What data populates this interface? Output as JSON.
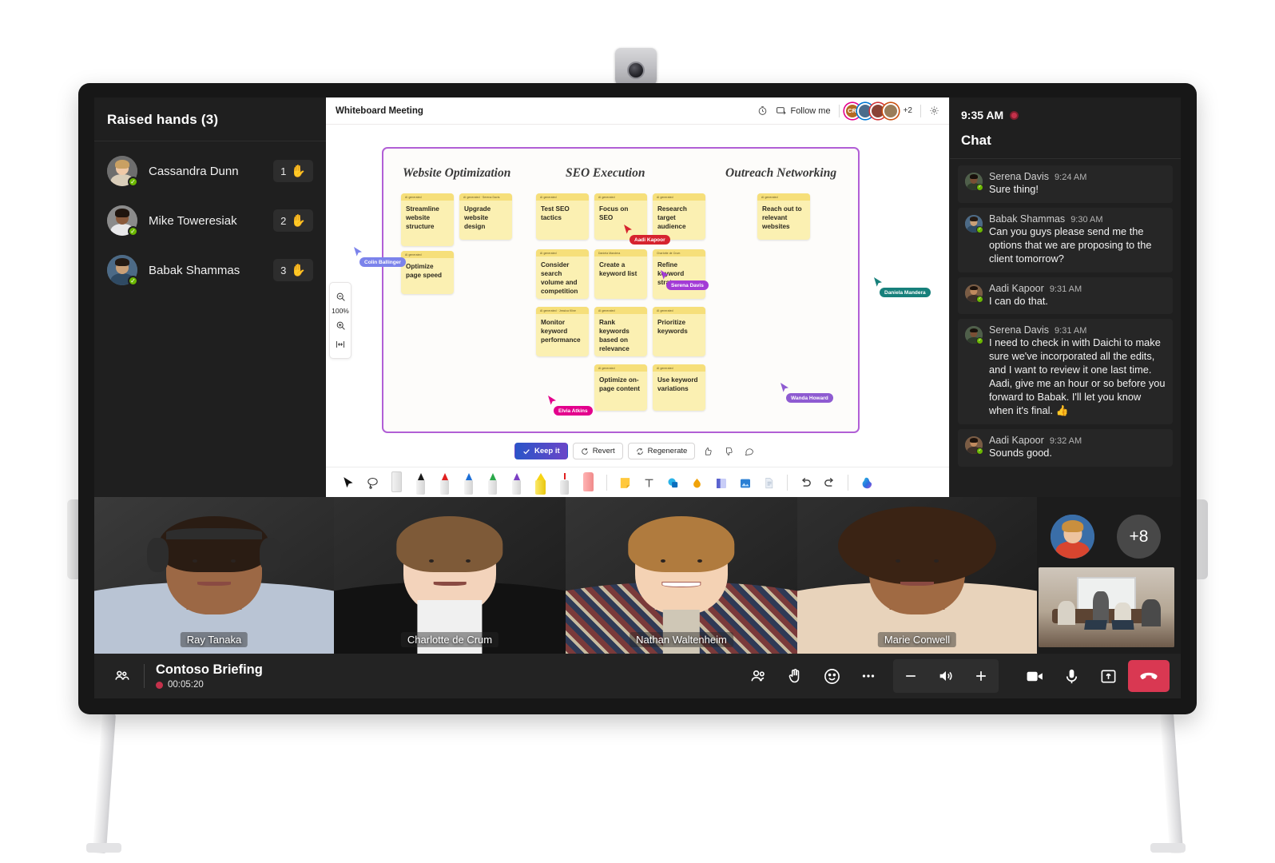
{
  "raised_hands": {
    "title": "Raised hands (3)",
    "items": [
      {
        "name": "Cassandra Dunn",
        "order": "1",
        "hand": "✋"
      },
      {
        "name": "Mike Toweresiak",
        "order": "2",
        "hand": "✋"
      },
      {
        "name": "Babak Shammas",
        "order": "3",
        "hand": "✋"
      }
    ]
  },
  "whiteboard": {
    "title": "Whiteboard Meeting",
    "follow_me": "Follow me",
    "facepile": {
      "initials": "CR",
      "overflow": "+2"
    },
    "zoom": {
      "level": "100%",
      "zoom_out": "zoom-out",
      "zoom_in": "zoom-in",
      "fit": "fit-to-screen"
    },
    "columns": [
      {
        "title": "Website Optimization"
      },
      {
        "title": "SEO Execution"
      },
      {
        "title": "Outreach Networking"
      }
    ],
    "notes": [
      {
        "header": "AI generated",
        "text": "Streamline website structure"
      },
      {
        "header": "AI generated · Serena Davis",
        "text": "Upgrade website design"
      },
      {
        "header": "AI generated",
        "text": "Optimize page speed"
      },
      {
        "header": "AI generated",
        "text": "Test SEO tactics"
      },
      {
        "header": "AI generated",
        "text": "Focus on SEO"
      },
      {
        "header": "AI generated",
        "text": "Research target audience"
      },
      {
        "header": "AI generated",
        "text": "Consider search volume and competition"
      },
      {
        "header": "Daniela Mandera",
        "text": "Create a keyword list"
      },
      {
        "header": "Charlotte de Crum",
        "text": "Refine keyword strategy"
      },
      {
        "header": "AI generated · Jessica Kline",
        "text": "Monitor keyword performance"
      },
      {
        "header": "AI generated",
        "text": "Rank keywords based on relevance"
      },
      {
        "header": "AI generated",
        "text": "Prioritize keywords"
      },
      {
        "header": "AI generated",
        "text": "Optimize on-page content"
      },
      {
        "header": "AI generated",
        "text": "Use keyword variations"
      },
      {
        "header": "AI generated",
        "text": "Reach out to relevant websites"
      }
    ],
    "cursors": [
      {
        "label": "Colin Ballinger",
        "color": "#7b83eb"
      },
      {
        "label": "Aadi Kapoor",
        "color": "#d6232f"
      },
      {
        "label": "Serena Davis",
        "color": "#a33bd6"
      },
      {
        "label": "Daniela Mandera",
        "color": "#17807b"
      },
      {
        "label": "Elvia Atkins",
        "color": "#e3008c"
      },
      {
        "label": "Wanda Howard",
        "color": "#8e5bd1"
      }
    ],
    "ai_bar": {
      "keep": "Keep it",
      "revert": "Revert",
      "regenerate": "Regenerate",
      "thumbs_up": "thumbs-up",
      "thumbs_down": "thumbs-down",
      "feedback": "feedback"
    },
    "toolbar": {
      "tools": [
        "cursor-tool",
        "lasso-select-tool",
        "ruler-tool",
        "pen-black",
        "pen-red",
        "pen-blue",
        "pen-green",
        "pen-purple",
        "highlighter-yellow",
        "laser-pointer-tool",
        "eraser-tool",
        "sticky-note-tool",
        "text-tool",
        "shapes-tool",
        "ink-color-tool",
        "template-tool",
        "image-tool",
        "document-tool",
        "undo-button",
        "redo-button",
        "copilot-button"
      ]
    }
  },
  "chat": {
    "clock": "9:35 AM",
    "title": "Chat",
    "messages": [
      {
        "author": "Serena Davis",
        "time": "9:24 AM",
        "text": "Sure thing!"
      },
      {
        "author": "Babak Shammas",
        "time": "9:30 AM",
        "text": "Can you guys please send me the options that we are proposing to the client tomorrow?"
      },
      {
        "author": "Aadi Kapoor",
        "time": "9:31 AM",
        "text": "I can do that."
      },
      {
        "author": "Serena Davis",
        "time": "9:31 AM",
        "text": "I need to check in with Daichi to make sure we've incorporated all the edits, and I want to review it one last time. Aadi, give me an hour or so before you forward to Babak. I'll let you know when it's final. 👍"
      },
      {
        "author": "Aadi Kapoor",
        "time": "9:32 AM",
        "text": "Sounds good."
      }
    ]
  },
  "video": {
    "participants": [
      {
        "name": "Ray Tanaka"
      },
      {
        "name": "Charlotte de Crum"
      },
      {
        "name": "Nathan Waltenheim"
      },
      {
        "name": "Marie Conwell"
      }
    ],
    "overflow_badge": "+8"
  },
  "meeting_bar": {
    "roster_icon": "people-roster-icon",
    "title": "Contoso Briefing",
    "timer": "00:05:20",
    "controls": [
      "people-button",
      "raise-hand-button",
      "reactions-button",
      "more-options-button",
      "volume-down-button",
      "speaker-button",
      "volume-up-button",
      "camera-button",
      "microphone-button",
      "share-screen-button",
      "hang-up-button"
    ]
  },
  "colors": {
    "accent": "#6264a7",
    "danger": "#d93852",
    "record": "#c4314b",
    "presence_available": "#6bb700",
    "note": "#fbf0b2",
    "note_header": "#f6df7a",
    "frame": "#b15fd6"
  }
}
